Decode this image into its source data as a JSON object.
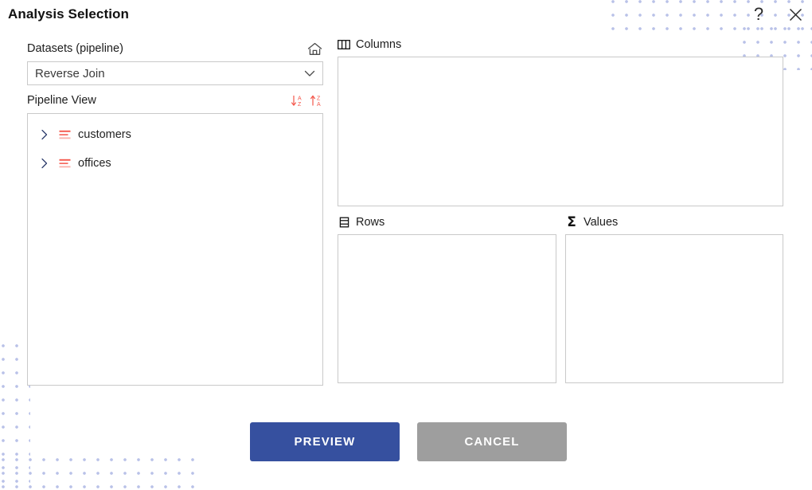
{
  "window": {
    "title": "Analysis Selection",
    "help_icon": "question-mark-icon",
    "close_icon": "close-icon"
  },
  "left_panel": {
    "datasets_label": "Datasets (pipeline)",
    "home_icon": "home-icon",
    "dataset_select": {
      "value": "Reverse Join",
      "chevron_icon": "chevron-down-icon"
    },
    "pipeline_view_label": "Pipeline View",
    "sort_asc_icon": "sort-a-z-descending-icon",
    "sort_desc_icon": "sort-z-a-ascending-icon",
    "tree_items": [
      {
        "label": "customers",
        "expander_icon": "chevron-right-icon",
        "type_icon": "table-icon",
        "expanded": false
      },
      {
        "label": "offices",
        "expander_icon": "chevron-right-icon",
        "type_icon": "table-icon",
        "expanded": false
      }
    ]
  },
  "zones": {
    "columns": {
      "label": "Columns",
      "icon": "columns-icon",
      "items": []
    },
    "rows": {
      "label": "Rows",
      "icon": "rows-icon",
      "items": []
    },
    "values": {
      "label": "Values",
      "icon": "sigma-icon",
      "items": []
    }
  },
  "footer": {
    "preview_label": "PREVIEW",
    "cancel_label": "CANCEL"
  },
  "colors": {
    "primary_blue": "#36509f",
    "cancel_gray": "#9e9e9e",
    "accent_red": "#f4564a",
    "border_gray": "#c9c9c9",
    "dot_pattern": "#b9c2e8",
    "chevron_navy": "#2b3a6b"
  }
}
